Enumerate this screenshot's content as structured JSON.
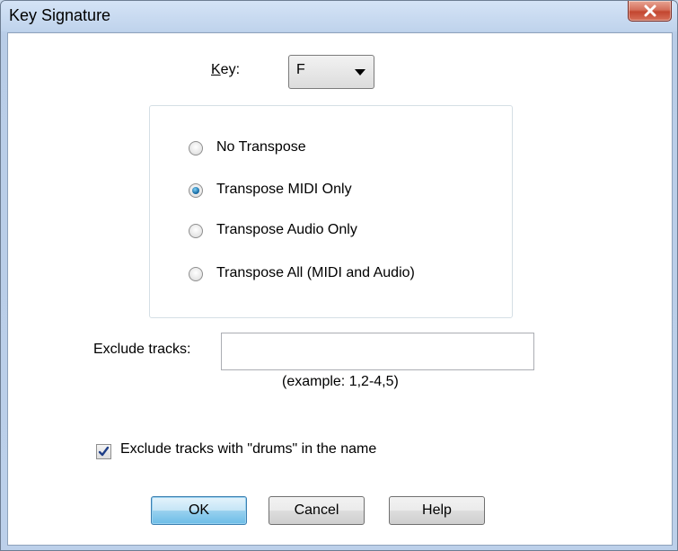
{
  "window": {
    "title": "Key Signature"
  },
  "key": {
    "label": "Key:",
    "selected": "F"
  },
  "transpose": {
    "options": [
      {
        "label": "No Transpose",
        "checked": false
      },
      {
        "label": "Transpose MIDI Only",
        "checked": true
      },
      {
        "label": "Transpose Audio Only",
        "checked": false
      },
      {
        "label": "Transpose All (MIDI and Audio)",
        "checked": false
      }
    ]
  },
  "exclude": {
    "label": "Exclude tracks:",
    "value": "",
    "example": "(example: 1,2-4,5)"
  },
  "drums": {
    "label": "Exclude tracks with \"drums\" in the name",
    "checked": true
  },
  "buttons": {
    "ok": "OK",
    "cancel": "Cancel",
    "help": "Help"
  }
}
